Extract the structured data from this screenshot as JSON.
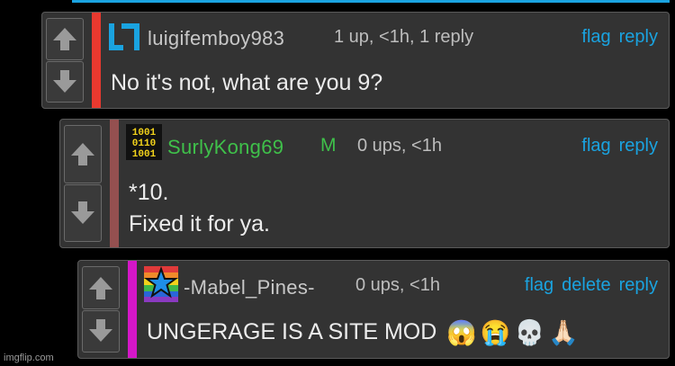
{
  "colors": {
    "link": "#1aa3e0",
    "mod": "#3fc04a",
    "accent_red": "#e8392f",
    "accent_brown": "#945050",
    "accent_magenta": "#d417c8"
  },
  "comments": [
    {
      "username": "luigifemboy983",
      "meta": "1 up, <1h, 1 reply",
      "actions": [
        "flag",
        "reply"
      ],
      "lines": [
        "No it's not, what are you 9?"
      ]
    },
    {
      "username": "SurlyKong69",
      "badge": "M",
      "meta": "0 ups, <1h",
      "actions": [
        "flag",
        "reply"
      ],
      "lines": [
        "*10.",
        "Fixed it for ya."
      ]
    },
    {
      "username": "-Mabel_Pines-",
      "meta": "0 ups, <1h",
      "actions": [
        "flag",
        "delete",
        "reply"
      ],
      "lines": [
        "UNGERAGE IS A SITE MOD"
      ],
      "emojis": [
        "😱",
        "😭",
        "💀",
        "🙏🏻"
      ]
    }
  ],
  "watermark": "imgflip.com",
  "icons": {
    "upvote": "up-arrow-icon",
    "downvote": "down-arrow-icon"
  }
}
